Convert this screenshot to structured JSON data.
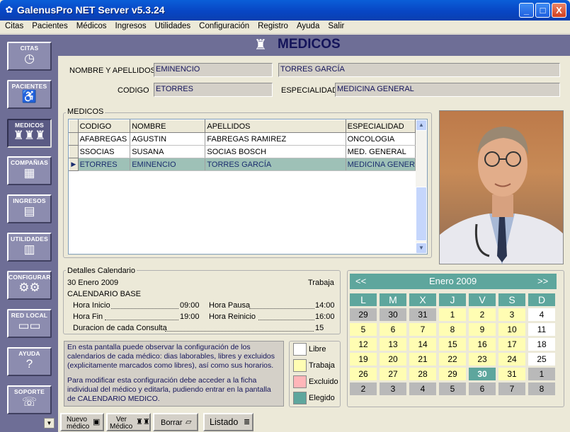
{
  "window": {
    "title": "GalenusPro NET Server v5.3.24",
    "min_symbol": "_",
    "max_symbol": "□",
    "close_symbol": "X"
  },
  "menu": [
    "Citas",
    "Pacientes",
    "Médicos",
    "Ingresos",
    "Utilidades",
    "Configuración",
    "Registro",
    "Ayuda",
    "Salir"
  ],
  "sidebar": [
    {
      "label": "CITAS",
      "icon": "clock-icon"
    },
    {
      "label": "PACIENTES",
      "icon": "patient-icon"
    },
    {
      "label": "MEDICOS",
      "icon": "doctors-icon"
    },
    {
      "label": "COMPAÑIAS",
      "icon": "building-icon"
    },
    {
      "label": "INGRESOS",
      "icon": "money-icon"
    },
    {
      "label": "UTILIDADES",
      "icon": "documents-icon"
    },
    {
      "label": "CONFIGURAR",
      "icon": "gears-icon"
    },
    {
      "label": "RED LOCAL",
      "icon": "network-icon"
    },
    {
      "label": "AYUDA",
      "icon": "help-icon"
    },
    {
      "label": "SOPORTE",
      "icon": "support-icon"
    }
  ],
  "header": {
    "title": "MEDICOS"
  },
  "form": {
    "name_label": "NOMBRE Y APELLIDOS",
    "first_name": "EMINENCIO",
    "last_name": "TORRES GARCÍA",
    "code_label": "CODIGO",
    "code": "ETORRES",
    "specialty_label": "ESPECIALIDAD",
    "specialty": "MEDICINA GENERAL"
  },
  "grid": {
    "group_title": "MEDICOS",
    "columns": [
      "CODIGO",
      "NOMBRE",
      "APELLIDOS",
      "ESPECIALIDAD"
    ],
    "rows": [
      [
        "AFABREGAS",
        "AGUSTIN",
        "FABREGAS RAMIREZ",
        "ONCOLOGIA"
      ],
      [
        "SSOCIAS",
        "SUSANA",
        "SOCIAS BOSCH",
        "MED. GENERAL"
      ],
      [
        "ETORRES",
        "EMINENCIO",
        "TORRES GARCÍA",
        "MEDICINA GENER"
      ]
    ],
    "selected_row": 2,
    "row_indicator": "▶"
  },
  "details": {
    "group_title": "Detalles Calendario",
    "date": "30 Enero 2009",
    "status": "Trabaja",
    "calendar_name": "CALENDARIO BASE",
    "start_label": "Hora Inicio",
    "start_value": "09:00",
    "pause_label": "Hora Pausa",
    "pause_value": "14:00",
    "end_label": "Hora Fin",
    "end_value": "19:00",
    "resume_label": "Hora Reinicio",
    "resume_value": "16:00",
    "duration_label": "Duracion de cada Consulta",
    "duration_value": "15"
  },
  "calendar": {
    "prev": "<<",
    "next": ">>",
    "month": "Enero 2009",
    "days": [
      "L",
      "M",
      "X",
      "J",
      "V",
      "S",
      "D"
    ],
    "weeks": [
      [
        [
          "29",
          "g"
        ],
        [
          "30",
          "g"
        ],
        [
          "31",
          "g"
        ],
        [
          "1",
          "y"
        ],
        [
          "2",
          "y"
        ],
        [
          "3",
          "y"
        ],
        [
          "4",
          "w"
        ]
      ],
      [
        [
          "5",
          "y"
        ],
        [
          "6",
          "y"
        ],
        [
          "7",
          "y"
        ],
        [
          "8",
          "y"
        ],
        [
          "9",
          "y"
        ],
        [
          "10",
          "y"
        ],
        [
          "11",
          "w"
        ]
      ],
      [
        [
          "12",
          "y"
        ],
        [
          "13",
          "y"
        ],
        [
          "14",
          "y"
        ],
        [
          "15",
          "y"
        ],
        [
          "16",
          "y"
        ],
        [
          "17",
          "y"
        ],
        [
          "18",
          "w"
        ]
      ],
      [
        [
          "19",
          "y"
        ],
        [
          "20",
          "y"
        ],
        [
          "21",
          "y"
        ],
        [
          "22",
          "y"
        ],
        [
          "23",
          "y"
        ],
        [
          "24",
          "y"
        ],
        [
          "25",
          "w"
        ]
      ],
      [
        [
          "26",
          "y"
        ],
        [
          "27",
          "y"
        ],
        [
          "28",
          "y"
        ],
        [
          "29",
          "y"
        ],
        [
          "30",
          "t"
        ],
        [
          "31",
          "y"
        ],
        [
          "1",
          "g"
        ]
      ],
      [
        [
          "2",
          "g"
        ],
        [
          "3",
          "g"
        ],
        [
          "4",
          "g"
        ],
        [
          "5",
          "g"
        ],
        [
          "6",
          "g"
        ],
        [
          "7",
          "g"
        ],
        [
          "8",
          "g"
        ]
      ]
    ]
  },
  "info": {
    "p1": "En esta pantalla puede observar la configuración de los calendarios de cada médico: dias laborables, libres y excluidos (explicitamente marcados como libres), así como sus horarios.",
    "p2": "Para modificar esta configuración debe acceder a la ficha individual del médico y editarla, pudiendo entrar en la pantalla de CALENDARIO MEDICO."
  },
  "legend": [
    {
      "label": "Libre",
      "color": "#ffffff"
    },
    {
      "label": "Trabaja",
      "color": "#fffdb3"
    },
    {
      "label": "Excluido",
      "color": "#ffb6b9"
    },
    {
      "label": "Elegido",
      "color": "#5ea69d"
    }
  ],
  "bottom": {
    "new_line1": "Nuevo",
    "new_line2": "médico",
    "view_line1": "Ver",
    "view_line2": "Médico",
    "delete": "Borrar",
    "list": "Listado"
  }
}
